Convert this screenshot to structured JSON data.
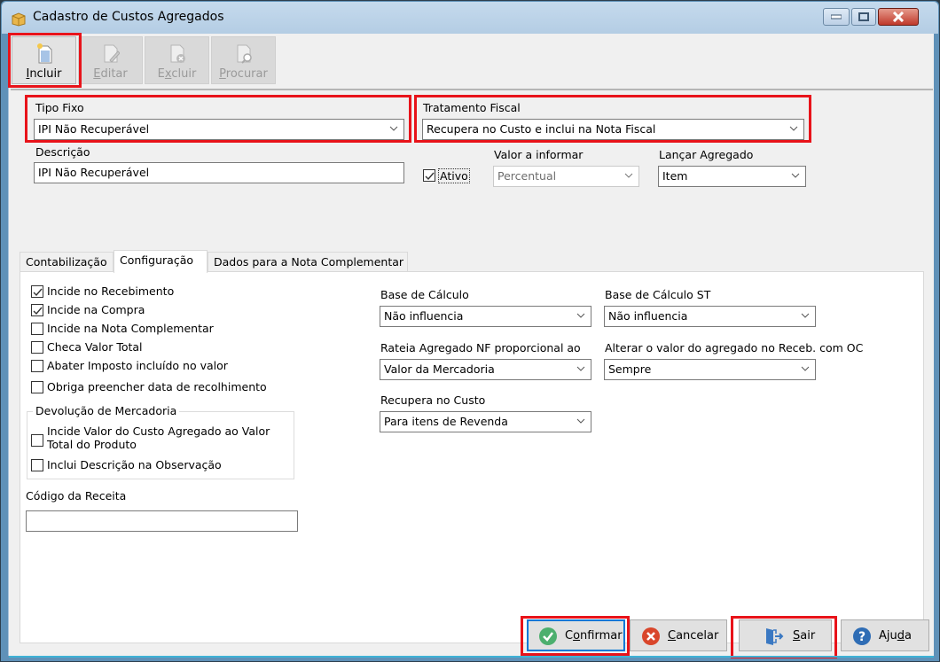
{
  "window": {
    "title": "Cadastro de Custos Agregados",
    "controls": {
      "minimize": "minimize",
      "maximize": "maximize",
      "close": "close"
    }
  },
  "toolbar": {
    "buttons": [
      {
        "label": "Incluir",
        "accel": "I",
        "rest": "ncluir",
        "enabled": true,
        "icon": "new-document-icon"
      },
      {
        "label": "Editar",
        "accel": "E",
        "rest": "ditar",
        "enabled": false,
        "icon": "edit-document-icon"
      },
      {
        "label": "Excluir",
        "pre": "E",
        "accel": "x",
        "rest": "cluir",
        "enabled": false,
        "icon": "delete-document-icon"
      },
      {
        "label": "Procurar",
        "accel": "P",
        "rest": "rocurar",
        "enabled": false,
        "icon": "search-document-icon"
      }
    ]
  },
  "form": {
    "tipo_fixo": {
      "label": "Tipo Fixo",
      "value": "IPI Não Recuperável"
    },
    "tratamento_fiscal": {
      "label": "Tratamento Fiscal",
      "value": "Recupera no Custo e inclui na Nota Fiscal"
    },
    "descricao": {
      "label": "Descrição",
      "value": "IPI Não Recuperável"
    },
    "ativo": {
      "label": "Ativo",
      "checked": true
    },
    "valor_a_informar": {
      "label": "Valor a informar",
      "value": "Percentual",
      "enabled": false
    },
    "lancar_agregado": {
      "label": "Lançar Agregado",
      "value": "Item"
    }
  },
  "tabs": [
    {
      "label": "Contabilização",
      "active": false
    },
    {
      "label": "Configuração",
      "active": true
    },
    {
      "label": "Dados para a Nota Complementar",
      "active": false
    }
  ],
  "config": {
    "checkboxes": [
      {
        "label": "Incide no Recebimento",
        "checked": true
      },
      {
        "label": "Incide na Compra",
        "checked": true
      },
      {
        "label": "Incide na Nota Complementar",
        "checked": false
      },
      {
        "label": "Checa Valor Total",
        "checked": false
      },
      {
        "label": "Abater Imposto incluído no valor",
        "checked": false
      },
      {
        "label": "Obriga preencher data de recolhimento",
        "checked": false
      }
    ],
    "devolucao": {
      "title": "Devolução de Mercadoria",
      "checkboxes": [
        {
          "label_line1": "Incide Valor do Custo Agregado ao Valor",
          "label_line2": "Total do Produto",
          "checked": false
        },
        {
          "label": "Inclui Descrição na Observação",
          "checked": false
        }
      ]
    },
    "codigo_receita": {
      "label": "Código da Receita",
      "value": ""
    },
    "base_calculo": {
      "label": "Base de Cálculo",
      "value": "Não influencia"
    },
    "base_calculo_st": {
      "label": "Base de Cálculo ST",
      "value": "Não influencia"
    },
    "rateia": {
      "label": "Rateia Agregado NF proporcional ao",
      "value": "Valor da Mercadoria"
    },
    "alterar_valor": {
      "label": "Alterar o valor do agregado no Receb. com OC",
      "value": "Sempre"
    },
    "recupera_custo": {
      "label": "Recupera no Custo",
      "value": "Para itens de Revenda"
    }
  },
  "footer": {
    "confirmar": {
      "pre": "C",
      "accel": "o",
      "rest": "nfirmar",
      "label": "Confirmar"
    },
    "cancelar": {
      "accel": "C",
      "rest": "ancelar",
      "label": "Cancelar"
    },
    "sair": {
      "accel": "S",
      "rest": "air",
      "label": "Sair"
    },
    "ajuda": {
      "pre": "Aju",
      "accel": "d",
      "rest": "a",
      "label": "Ajuda"
    }
  },
  "colors": {
    "highlight": "#e8131a",
    "confirm_green": "#4caf6e",
    "cancel_red": "#d9462b",
    "help_blue": "#2f6db5",
    "exit_blue": "#3a78c2"
  }
}
